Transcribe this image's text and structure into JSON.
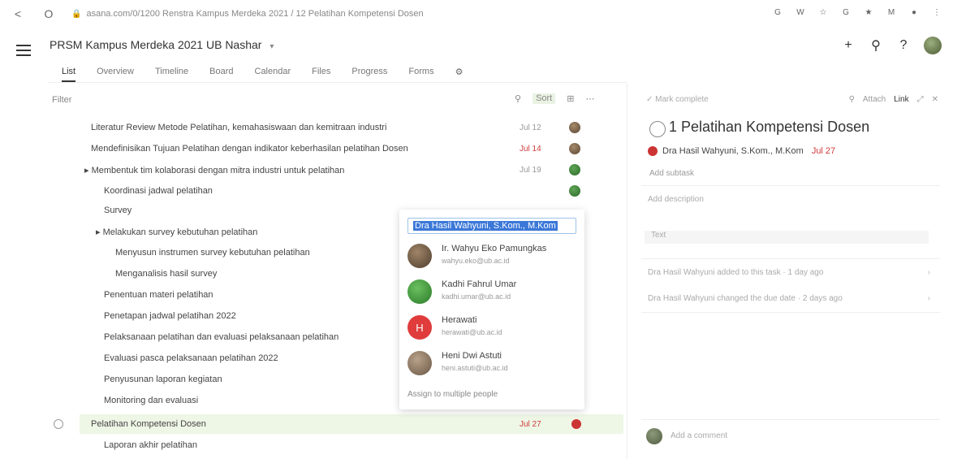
{
  "browser": {
    "back": "<",
    "reload": "O",
    "url": "asana.com/0/1200 Renstra Kampus Merdeka 2021 / 12 Pelatihan Kompetensi Dosen",
    "extensions": [
      "G",
      "W",
      "☆",
      "G",
      "★",
      "M",
      "●",
      "⋮"
    ]
  },
  "header": {
    "title": "PRSM Kampus Merdeka 2021 UB Nashar",
    "chevron": "▾",
    "plus": "+",
    "search": "⚲",
    "help": "?"
  },
  "tabs": [
    "List",
    "Overview",
    "Timeline",
    "Board",
    "Calendar",
    "Files",
    "Progress",
    "Forms",
    "⚙"
  ],
  "toolbar": {
    "filter": "Filter",
    "tools": [
      "⚲",
      "Sort",
      "⊞",
      "⋯"
    ]
  },
  "tasks": [
    {
      "label": "Literatur Review Metode Pelatihan, kemahasiswaan dan kemitraan industri",
      "meta": "Jul 12"
    },
    {
      "label": "Mendefinisikan Tujuan Pelatihan dengan indikator keberhasilan pelatihan Dosen",
      "meta": "Jul 14"
    },
    {
      "label": "▸ Membentuk tim kolaborasi dengan mitra industri untuk pelatihan",
      "meta": "Jul 19"
    },
    {
      "label": "Koordinasi jadwal pelatihan",
      "meta": ""
    },
    {
      "label": "Survey",
      "meta": ""
    },
    {
      "label": "▸ Melakukan survey kebutuhan pelatihan",
      "meta": ""
    },
    {
      "label": "Menyusun instrumen survey kebutuhan pelatihan",
      "meta": ""
    },
    {
      "label": "Menganalisis hasil survey",
      "meta": ""
    },
    {
      "label": "Penentuan materi pelatihan",
      "meta": ""
    },
    {
      "label": "Penetapan jadwal pelatihan 2022",
      "meta": ""
    },
    {
      "label": "Pelaksanaan pelatihan dan evaluasi pelaksanaan pelatihan",
      "meta": ""
    },
    {
      "label": "Evaluasi pasca pelaksanaan pelatihan 2022",
      "meta": ""
    },
    {
      "label": "Penyusunan laporan kegiatan",
      "meta": ""
    },
    {
      "label": "Monitoring dan evaluasi",
      "meta": ""
    }
  ],
  "selected_task": {
    "label": "Pelatihan Kompetensi Dosen",
    "meta": "Jul 27"
  },
  "last_task": "Laporan akhir pelatihan",
  "popup": {
    "input": "Dra Hasil Wahyuni, S.Kom., M.Kom",
    "people": [
      {
        "name": "Ir. Wahyu Eko Pamungkas",
        "email": "wahyu.eko@ub.ac.id",
        "initial": "",
        "color": "#6b5a46"
      },
      {
        "name": "Kadhi Fahrul Umar",
        "email": "kadhi.umar@ub.ac.id",
        "initial": "",
        "color": "#3f8f3a"
      },
      {
        "name": "Herawati",
        "email": "herawati@ub.ac.id",
        "initial": "H",
        "color": "#e03c3c"
      },
      {
        "name": "Heni Dwi Astuti",
        "email": "heni.astuti@ub.ac.id",
        "initial": "",
        "color": "#8a7460"
      }
    ],
    "footer": "Assign to multiple people"
  },
  "detail": {
    "mark_complete": "✓ Mark complete",
    "tools": [
      "⚲",
      "Attach",
      "Link",
      "⤢",
      "✕"
    ],
    "title": "1 Pelatihan Kompetensi Dosen",
    "assignee": "Dra Hasil Wahyuni, S.Kom., M.Kom",
    "due": "Jul 27",
    "sub": "Add subtask",
    "description_label": "Add description",
    "box": "Text",
    "links": [
      "Dra Hasil Wahyuni added to this task · 1 day ago",
      "Dra Hasil Wahyuni changed the due date · 2 days ago"
    ],
    "comment_placeholder": "Add a comment"
  },
  "colors": {
    "accent": "#3b78d8",
    "due_red": "#d13b3b",
    "row_highlight": "#eef6e6"
  }
}
